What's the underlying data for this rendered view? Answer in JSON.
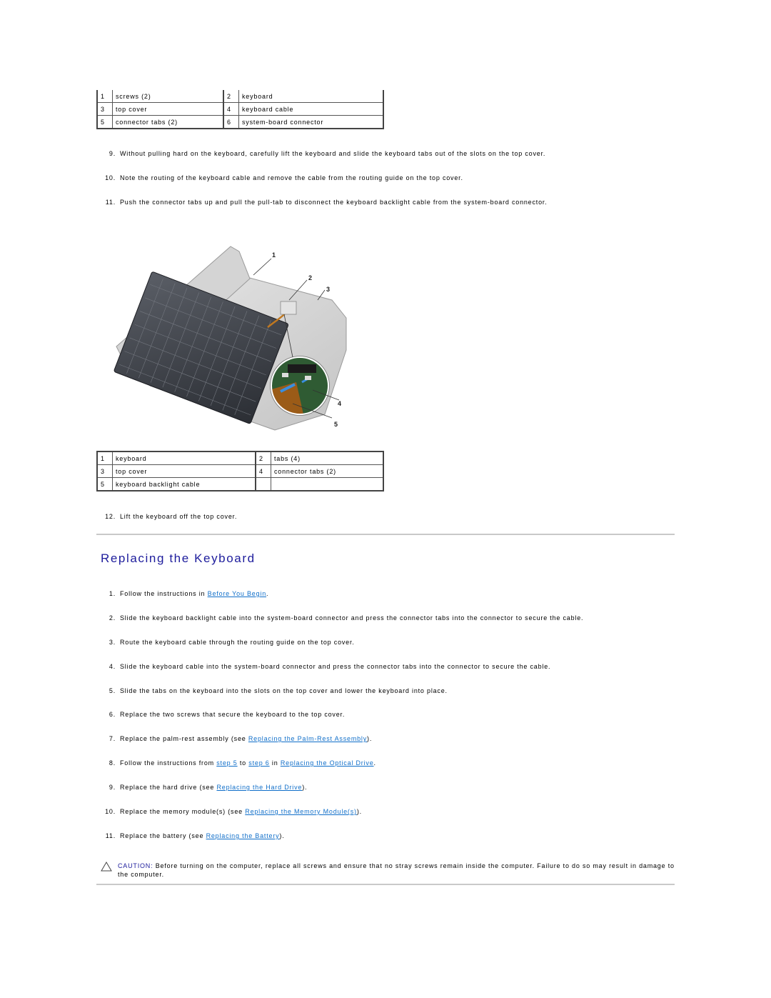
{
  "table1": {
    "rows": [
      [
        {
          "num": "1",
          "label": "screws (2)"
        },
        {
          "num": "2",
          "label": "keyboard"
        }
      ],
      [
        {
          "num": "3",
          "label": "top cover"
        },
        {
          "num": "4",
          "label": "keyboard cable"
        }
      ],
      [
        {
          "num": "5",
          "label": "connector tabs (2)"
        },
        {
          "num": "6",
          "label": "system-board connector"
        }
      ]
    ]
  },
  "removal_steps": [
    {
      "num": "9.",
      "text": "Without pulling hard on the keyboard, carefully lift the keyboard and slide the keyboard tabs out of the slots on the top cover."
    },
    {
      "num": "10.",
      "text": "Note the routing of the keyboard cable and remove the cable from the routing guide on the top cover."
    },
    {
      "num": "11.",
      "text": "Push the connector tabs up and pull the pull-tab to disconnect the keyboard backlight cable from the system-board connector."
    }
  ],
  "figure": {
    "callouts": [
      "1",
      "2",
      "3",
      "4",
      "5"
    ]
  },
  "table2": {
    "rows": [
      [
        {
          "num": "1",
          "label": "keyboard"
        },
        {
          "num": "2",
          "label": "tabs (4)"
        }
      ],
      [
        {
          "num": "3",
          "label": "top cover"
        },
        {
          "num": "4",
          "label": "connector tabs (2)"
        }
      ],
      [
        {
          "num": "5",
          "label": "keyboard backlight cable"
        },
        {
          "num": "",
          "label": ""
        }
      ]
    ]
  },
  "final_removal_step": {
    "num": "12.",
    "text": "Lift the keyboard off the top cover."
  },
  "section_title": "Replacing the Keyboard",
  "replace_steps": {
    "s1": {
      "num": "1.",
      "pre": "Follow the instructions in ",
      "link": "Before You Begin",
      "post": "."
    },
    "s2": {
      "num": "2.",
      "text": "Slide the keyboard backlight cable into the system-board connector and press the connector tabs into the connector to secure the cable."
    },
    "s3": {
      "num": "3.",
      "text": "Route the keyboard cable through the routing guide on the top cover."
    },
    "s4": {
      "num": "4.",
      "text": "Slide the keyboard cable into the system-board connector and press the connector tabs into the connector to secure the cable."
    },
    "s5": {
      "num": "5.",
      "text": "Slide the tabs on the keyboard into the slots on the top cover and lower the keyboard into place."
    },
    "s6": {
      "num": "6.",
      "text": "Replace the two screws that secure the keyboard to the top cover."
    },
    "s7": {
      "num": "7.",
      "pre": "Replace the palm-rest assembly (see ",
      "link": "Replacing the Palm-Rest Assembly",
      "post": ")."
    },
    "s8": {
      "num": "8.",
      "pre": "Follow the instructions from ",
      "link1": "step 5",
      "mid1": " to ",
      "link2": "step 6",
      "mid2": " in ",
      "link3": "Replacing the Optical Drive",
      "post": "."
    },
    "s9": {
      "num": "9.",
      "pre": "Replace the hard drive (see ",
      "link": "Replacing the Hard Drive",
      "post": ")."
    },
    "s10": {
      "num": "10.",
      "pre": "Replace the memory module(s) (see ",
      "link": "Replacing the Memory Module(s)",
      "post": ")."
    },
    "s11": {
      "num": "11.",
      "pre": "Replace the battery (see ",
      "link": "Replacing the Battery",
      "post": ")."
    }
  },
  "caution": {
    "icon": "warning-triangle-icon",
    "label": "CAUTION:",
    "text": " Before turning on the computer, replace all screws and ensure that no stray screws remain inside the computer. Failure to do so may result in damage to the computer."
  },
  "colors": {
    "heading": "#1d1c9c",
    "link": "#0f6ec9",
    "rule": "#c9c9c9"
  }
}
